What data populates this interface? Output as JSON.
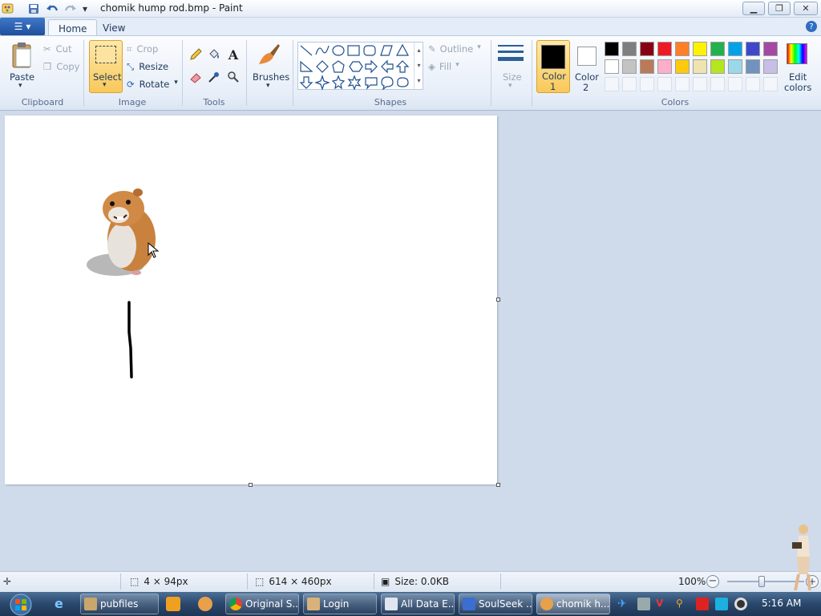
{
  "window": {
    "title": "chomik hump rod.bmp - Paint"
  },
  "tabs": {
    "home": "Home",
    "view": "View"
  },
  "ribbon": {
    "clipboard": {
      "label": "Clipboard",
      "paste": "Paste",
      "cut": "Cut",
      "copy": "Copy"
    },
    "image": {
      "label": "Image",
      "select": "Select",
      "crop": "Crop",
      "resize": "Resize",
      "rotate": "Rotate"
    },
    "tools": {
      "label": "Tools"
    },
    "brushes": {
      "label": "Brushes"
    },
    "shapes": {
      "label": "Shapes",
      "outline": "Outline",
      "fill": "Fill"
    },
    "size": {
      "label": "Size"
    },
    "colors": {
      "label": "Colors",
      "color1_line1": "Color",
      "color1_line2": "1",
      "color2_line1": "Color",
      "color2_line2": "2",
      "edit_line1": "Edit",
      "edit_line2": "colors",
      "color1_value": "#000000",
      "color2_value": "#ffffff",
      "palette_row1": [
        "#000000",
        "#7f7f7f",
        "#880015",
        "#ed1c24",
        "#ff7f27",
        "#fff200",
        "#22b14c",
        "#00a2e8",
        "#3f48cc",
        "#a349a4"
      ],
      "palette_row2": [
        "#ffffff",
        "#c3c3c3",
        "#b97a57",
        "#ffaec9",
        "#ffc90e",
        "#efe4b0",
        "#b5e61d",
        "#99d9ea",
        "#7092be",
        "#c8bfe7"
      ]
    }
  },
  "statusbar": {
    "selection_size": "4 × 94px",
    "canvas_size": "614 × 460px",
    "file_size": "Size: 0.0KB",
    "zoom": "100%"
  },
  "taskbar": {
    "items": [
      "pubfiles",
      "Original S...",
      "Login",
      "All Data E...",
      "SoulSeek ...",
      "chomik h..."
    ],
    "clock": "5:16 AM"
  }
}
